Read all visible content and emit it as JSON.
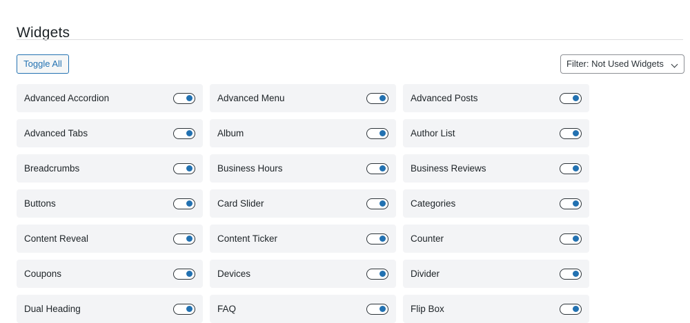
{
  "page": {
    "title": "Widgets"
  },
  "toolbar": {
    "toggle_all_label": "Toggle All",
    "filter_label": "Filter: Not Used Widgets"
  },
  "colors": {
    "accent": "#2271b1",
    "card_bg": "#f3f4f6",
    "text": "#1d2327"
  },
  "widgets": [
    {
      "label": "Advanced Accordion",
      "enabled": true
    },
    {
      "label": "Advanced Menu",
      "enabled": true
    },
    {
      "label": "Advanced Posts",
      "enabled": true
    },
    {
      "label": "Advanced Tabs",
      "enabled": true
    },
    {
      "label": "Album",
      "enabled": true
    },
    {
      "label": "Author List",
      "enabled": true
    },
    {
      "label": "Breadcrumbs",
      "enabled": true
    },
    {
      "label": "Business Hours",
      "enabled": true
    },
    {
      "label": "Business Reviews",
      "enabled": true
    },
    {
      "label": "Buttons",
      "enabled": true
    },
    {
      "label": "Card Slider",
      "enabled": true
    },
    {
      "label": "Categories",
      "enabled": true
    },
    {
      "label": "Content Reveal",
      "enabled": true
    },
    {
      "label": "Content Ticker",
      "enabled": true
    },
    {
      "label": "Counter",
      "enabled": true
    },
    {
      "label": "Coupons",
      "enabled": true
    },
    {
      "label": "Devices",
      "enabled": true
    },
    {
      "label": "Divider",
      "enabled": true
    },
    {
      "label": "Dual Heading",
      "enabled": true
    },
    {
      "label": "FAQ",
      "enabled": true
    },
    {
      "label": "Flip Box",
      "enabled": true
    }
  ]
}
